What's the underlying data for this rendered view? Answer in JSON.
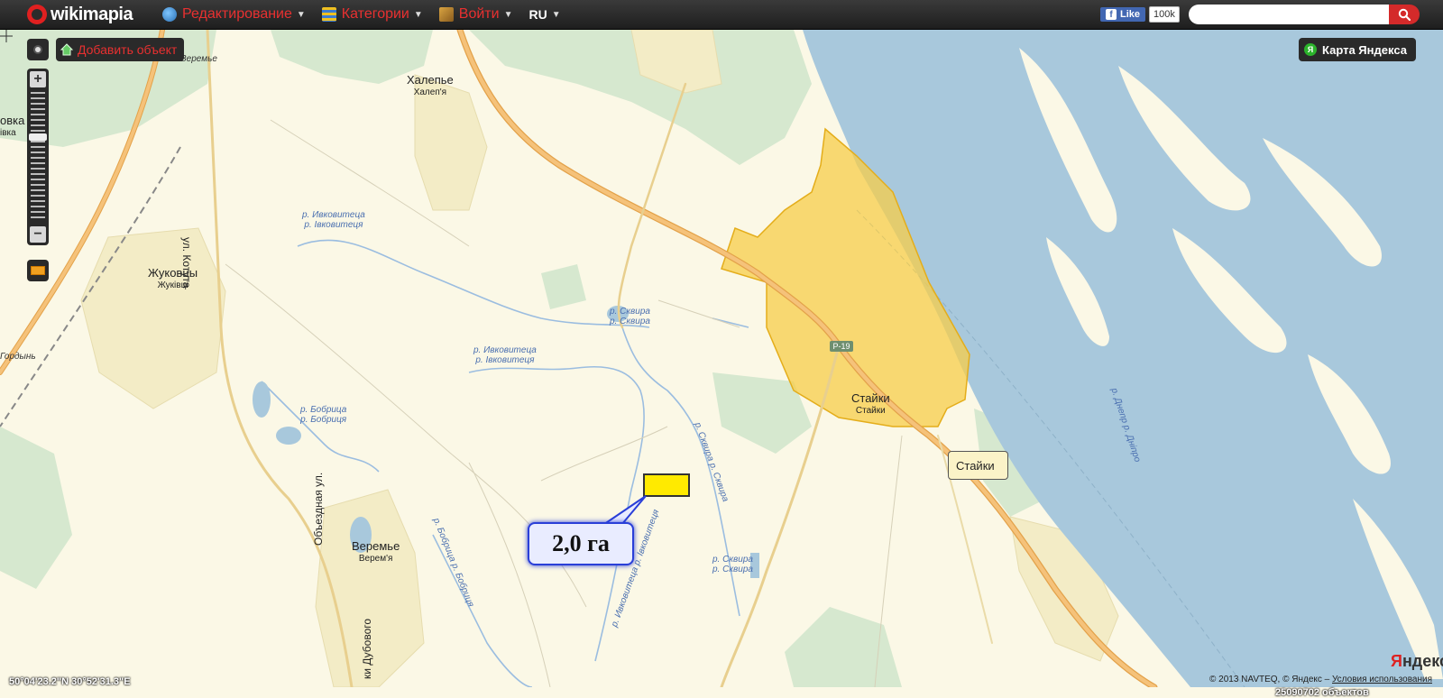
{
  "topbar": {
    "logo_text": "wikimapia",
    "menu": [
      {
        "label": "Редактирование",
        "icon": "edit-globe-icon"
      },
      {
        "label": "Категории",
        "icon": "categories-icon"
      },
      {
        "label": "Войти",
        "icon": "login-icon"
      }
    ],
    "language": "RU",
    "facebook": {
      "like_label": "Like",
      "count": "100k"
    },
    "search": {
      "placeholder": "",
      "value": ""
    }
  },
  "controls": {
    "add_object_label": "Добавить объект",
    "yandex_map_label": "Карта Яндекса"
  },
  "places": [
    {
      "name": "Халепье",
      "sub": "Халеп'я"
    },
    {
      "name": "Жуковцы",
      "sub": "Жуківці"
    },
    {
      "name": "Веремье",
      "sub": "Верем'я"
    },
    {
      "name": "Стайки",
      "sub": "Стайки"
    },
    {
      "name": "овка",
      "sub": "івка"
    }
  ],
  "small_labels": {
    "veremye_top": "Веремье",
    "gordyn": "Гордынь",
    "road_p19": "Р-19",
    "street_kotuta": "ул. Котута",
    "street_obyezdnaya": "Объездная ул.",
    "street_dubovogo": "ки Дубового"
  },
  "rivers": [
    {
      "name": "р. Ивковитеца",
      "sub": "р. Івковитеця"
    },
    {
      "name": "р. Сквира",
      "sub": "р. Сквира"
    },
    {
      "name": "р. Ивковитеца",
      "sub": "р. Івковитеця"
    },
    {
      "name": "р. Бобрица",
      "sub": "р. Бобриця"
    },
    {
      "name": "р. Сквира",
      "sub": "р. Сквира"
    },
    {
      "name": "р. Днепр р. Дніпро",
      "sub": ""
    },
    {
      "name": "р. Сквира р. Сквира",
      "sub": ""
    },
    {
      "name": "р. Бобрица р. Бобриця",
      "sub": ""
    },
    {
      "name": "р. Ивковитеца р. Івковитеця",
      "sub": ""
    }
  ],
  "tooltip_text": "Стайки",
  "callout_text": "2,0 га",
  "coordinates": "50°04'23.2\"N 30°52'31.3\"E",
  "objects_count": "25090702 объектов",
  "yandex_logo": {
    "first": "Я",
    "rest": "ндекс"
  },
  "copyright": {
    "text": "© 2013 NAVTEQ, © Яндекс –",
    "link": "Условия использования"
  },
  "colors": {
    "water": "#a8c8dc",
    "land": "#fbf8e6",
    "forest": "#d6e8cf",
    "settlement": "#f3ecc6",
    "highlight": "#f7cd4a",
    "road": "#f2b65c",
    "accent_red": "#e83030"
  }
}
